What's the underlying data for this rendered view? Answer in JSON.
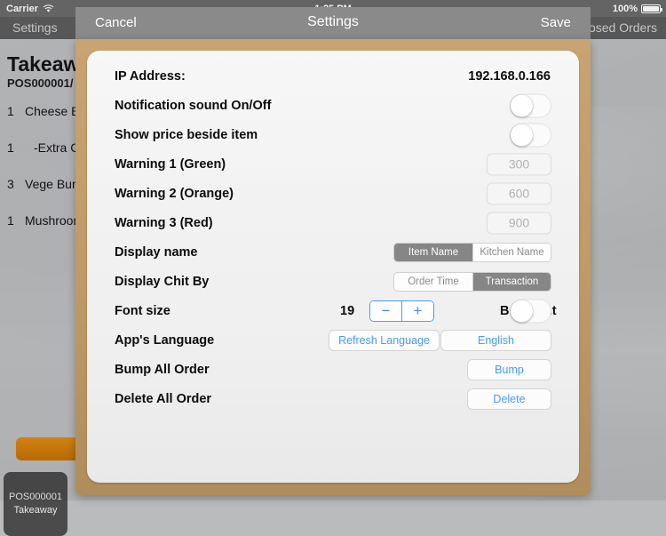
{
  "status_bar": {
    "carrier": "Carrier",
    "wifi_icon": "wifi-icon",
    "time": "1:25 PM",
    "battery_percent": "100%",
    "battery_icon": "battery-full-icon"
  },
  "background_app": {
    "nav_left_label": "Settings",
    "nav_right_label": "Closed Orders",
    "ticket": {
      "title": "Takeaway",
      "subtitle": "POS000001/",
      "items": [
        {
          "qty": "1",
          "name": "Cheese B",
          "indent": false
        },
        {
          "qty": "1",
          "name": "-Extra Ch",
          "indent": true
        },
        {
          "qty": "3",
          "name": "Vege Burg",
          "indent": false
        },
        {
          "qty": "1",
          "name": "Mushroom",
          "indent": false
        }
      ]
    },
    "pos_tile": {
      "line1": "POS000001",
      "line2": "Takeaway"
    }
  },
  "modal": {
    "cancel_label": "Cancel",
    "title": "Settings",
    "save_label": "Save",
    "rows": {
      "ip_address": {
        "label": "IP Address:",
        "value": "192.168.0.166"
      },
      "notification_sound": {
        "label": "Notification sound On/Off",
        "state": "off"
      },
      "show_price": {
        "label": "Show price beside item",
        "state": "off"
      },
      "warning1": {
        "label": "Warning 1 (Green)",
        "placeholder": "300",
        "value": ""
      },
      "warning2": {
        "label": "Warning 2 (Orange)",
        "placeholder": "600",
        "value": ""
      },
      "warning3": {
        "label": "Warning 3 (Red)",
        "placeholder": "900",
        "value": ""
      },
      "display_name": {
        "label": "Display name",
        "options": [
          "Item Name",
          "Kitchen Name"
        ],
        "selected": "Item Name"
      },
      "display_chit_by": {
        "label": "Display Chit By",
        "options": [
          "Order Time",
          "Transaction"
        ],
        "selected": "Transaction"
      },
      "font_size": {
        "label": "Font size",
        "value": "19",
        "decrement_label": "−",
        "increment_label": "+"
      },
      "bold_font": {
        "label": "Bold font",
        "state": "off"
      },
      "app_language": {
        "label": "App's Language",
        "refresh_label": "Refresh Language",
        "current_language": "English"
      },
      "bump_all": {
        "label": "Bump All Order",
        "button_label": "Bump"
      },
      "delete_all": {
        "label": "Delete All Order",
        "button_label": "Delete"
      }
    }
  },
  "colors": {
    "accent_blue": "#4a9bf5",
    "modal_frame_tan": "#c19a66",
    "header_gray": "#8a8a8a",
    "segment_active": "#868686"
  }
}
